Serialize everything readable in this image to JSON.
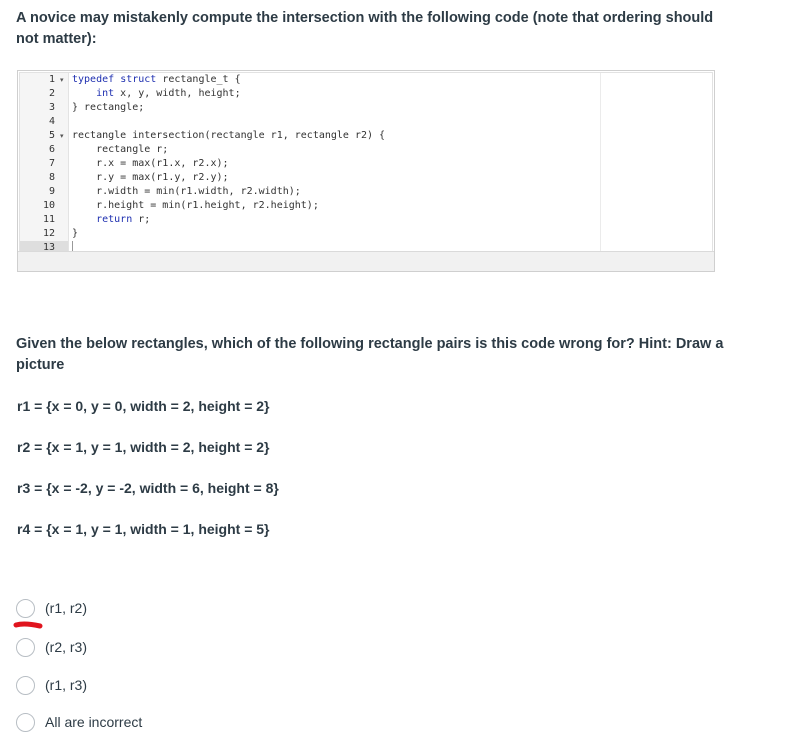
{
  "question1": {
    "text": "A novice may mistakenly compute the intersection with the following code (note that ordering should not matter):"
  },
  "code_editor": {
    "lines": [
      {
        "n": "1",
        "text": "typedef struct rectangle_t {",
        "fold": true
      },
      {
        "n": "2",
        "text": "    int x, y, width, height;",
        "fold": false
      },
      {
        "n": "3",
        "text": "} rectangle;",
        "fold": false
      },
      {
        "n": "4",
        "text": "",
        "fold": false
      },
      {
        "n": "5",
        "text": "rectangle intersection(rectangle r1, rectangle r2) {",
        "fold": true
      },
      {
        "n": "6",
        "text": "    rectangle r;",
        "fold": false
      },
      {
        "n": "7",
        "text": "    r.x = max(r1.x, r2.x);",
        "fold": false
      },
      {
        "n": "8",
        "text": "    r.y = max(r1.y, r2.y);",
        "fold": false
      },
      {
        "n": "9",
        "text": "    r.width = min(r1.width, r2.width);",
        "fold": false
      },
      {
        "n": "10",
        "text": "    r.height = min(r1.height, r2.height);",
        "fold": false
      },
      {
        "n": "11",
        "text": "    return r;",
        "fold": false
      },
      {
        "n": "12",
        "text": "}",
        "fold": false
      },
      {
        "n": "13",
        "text": "",
        "fold": false
      }
    ]
  },
  "question2": {
    "text": "Given the below rectangles, which of the following rectangle pairs is this code wrong for? Hint: Draw a picture"
  },
  "rectangles": [
    "r1 = {x = 0, y = 0, width =  2, height = 2}",
    "r2 = {x = 1, y = 1, width = 2, height = 2}",
    "r3 = {x = -2, y = -2, width = 6, height = 8}",
    "r4 = {x = 1, y = 1, width = 1, height = 5}"
  ],
  "options": [
    {
      "label": "(r1, r2)",
      "selected": false
    },
    {
      "label": "(r2, r3)",
      "selected": false
    },
    {
      "label": "(r1, r3)",
      "selected": false
    },
    {
      "label": "All are incorrect",
      "selected": false
    }
  ],
  "colors": {
    "text": "#2d3b45",
    "keyword": "#1e2fb0",
    "type_keyword": "#7a2ea8",
    "annotation_mark": "#e0141e",
    "radio_border": "#b8bec4"
  }
}
